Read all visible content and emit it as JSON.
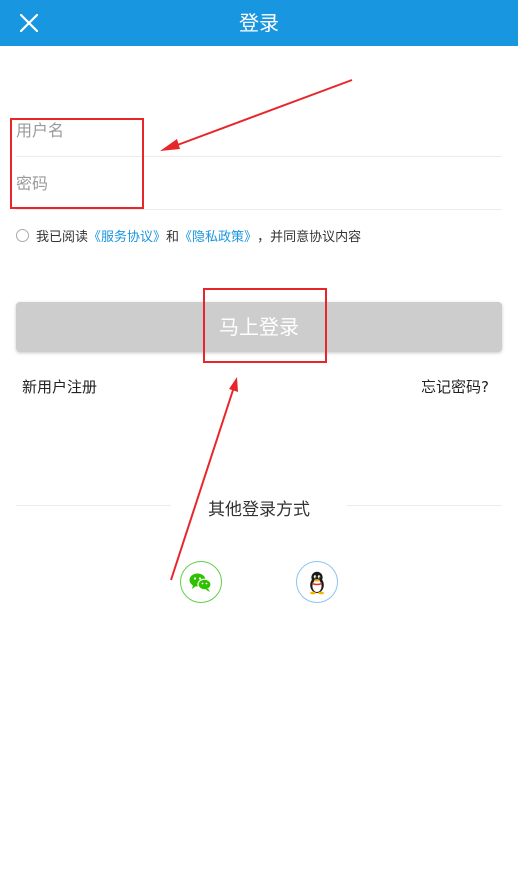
{
  "header": {
    "title": "登录",
    "close_icon": "close-icon"
  },
  "form": {
    "username_placeholder": "用户名",
    "password_placeholder": "密码"
  },
  "agreement": {
    "prefix": "我已阅读",
    "service_link": "《服务协议》",
    "and": "和",
    "privacy_link": "《隐私政策》",
    "suffix": "，并同意协议内容"
  },
  "login_button": "马上登录",
  "register_link": "新用户注册",
  "forgot_link": "忘记密码?",
  "other_login": {
    "label": "其他登录方式",
    "options": [
      "wechat-icon",
      "qq-icon"
    ]
  },
  "colors": {
    "header": "#1996e0",
    "link": "#1996e0",
    "button_disabled": "#cdcdcd",
    "annotation": "#e8262a",
    "wechat": "#2dc100"
  }
}
